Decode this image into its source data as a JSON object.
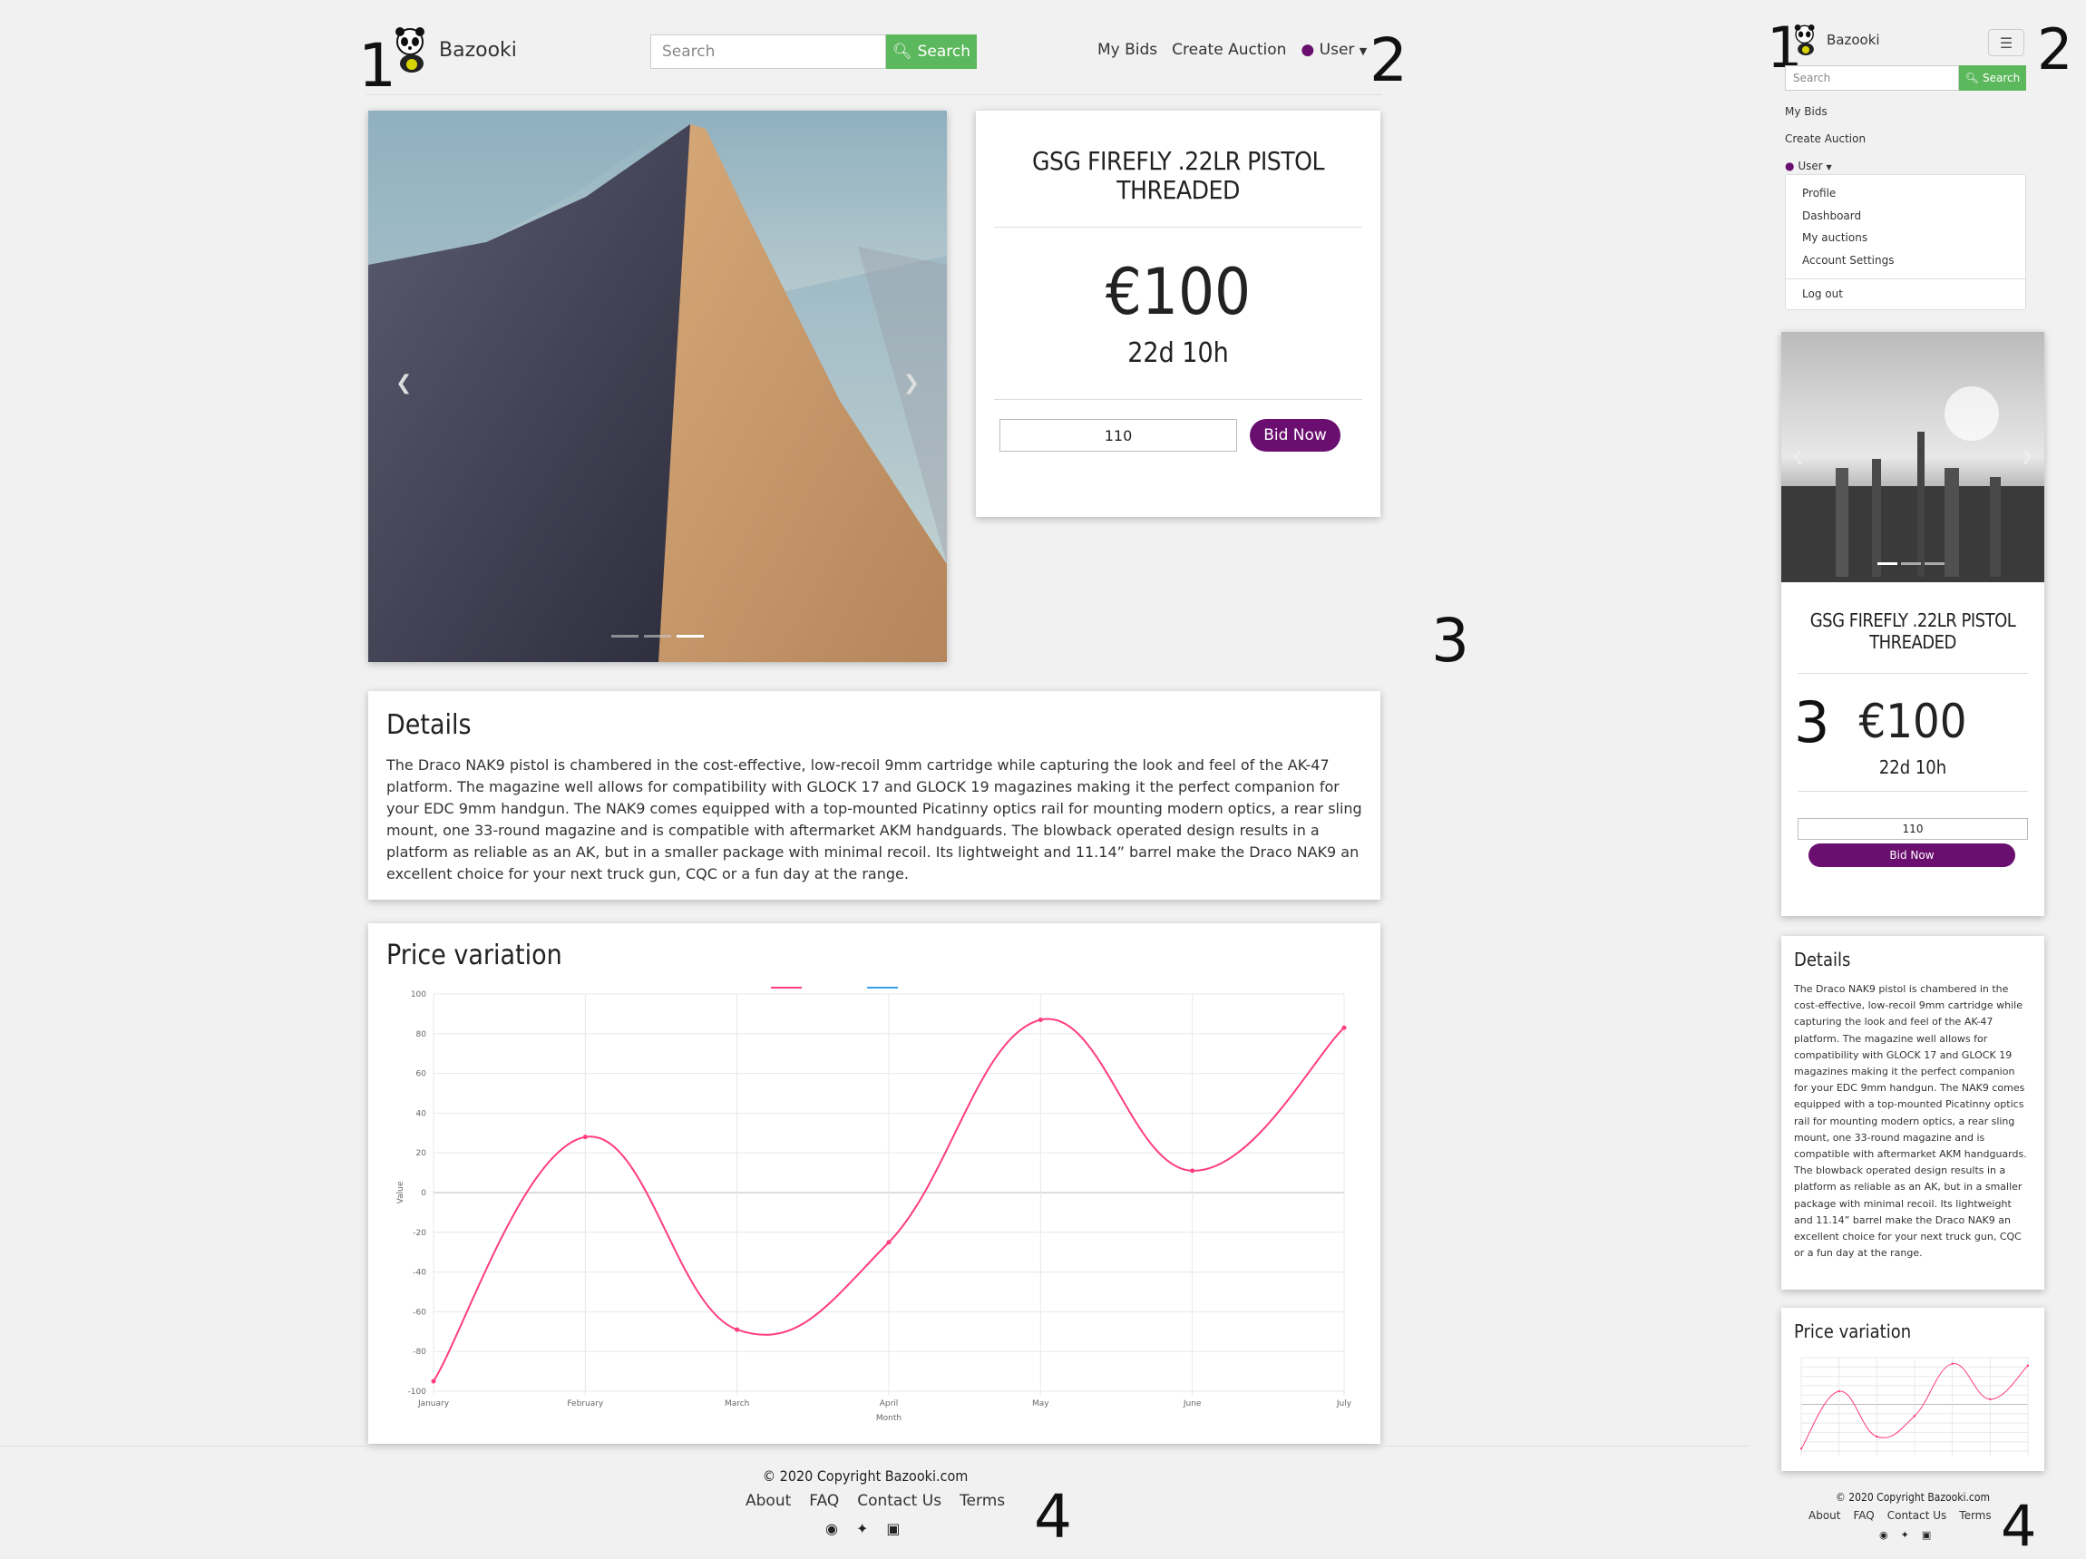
{
  "brand": {
    "name": "Bazooki"
  },
  "search": {
    "placeholder": "Search",
    "button": "Search"
  },
  "nav": {
    "my_bids": "My Bids",
    "create_auction": "Create Auction",
    "user": "User"
  },
  "user_menu": {
    "items": [
      "Profile",
      "Dashboard",
      "My auctions",
      "Account Settings"
    ],
    "logout": "Log out"
  },
  "auction": {
    "title": "GSG FIREFLY .22LR PISTOL THREADED",
    "price": "€100",
    "time_left": "22d 10h",
    "bid_value": "110",
    "bid_button": "Bid Now"
  },
  "details": {
    "heading": "Details",
    "text": "The Draco NAK9 pistol is chambered in the cost-effective, low-recoil 9mm cartridge while capturing the look and feel of the AK-47 platform. The magazine well allows for compatibility with GLOCK 17 and GLOCK 19 magazines making it the perfect companion for your EDC 9mm handgun. The NAK9 comes equipped with a top-mounted Picatinny optics rail for mounting modern optics, a rear sling mount, one 33-round magazine and is compatible with aftermarket AKM handguards. The blowback operated design results in a platform as reliable as an AK, but in a smaller package with minimal recoil. Its lightweight and 11.14” barrel make the Draco NAK9 an excellent choice for your next truck gun, CQC or a fun day at the range."
  },
  "price_chart": {
    "heading": "Price variation"
  },
  "chart_data": {
    "type": "line",
    "categories": [
      "January",
      "February",
      "March",
      "April",
      "May",
      "June",
      "July"
    ],
    "series": [
      {
        "values": [
          -95,
          28,
          -69,
          -25,
          87,
          11,
          83
        ],
        "color": "#ff3d7f"
      },
      {
        "values": [],
        "color": "#36a2eb"
      }
    ],
    "xlabel": "Month",
    "ylabel": "Value",
    "ylim": [
      -100,
      100
    ],
    "yticks": [
      100,
      80,
      60,
      40,
      20,
      0,
      -20,
      -40,
      -60,
      -80,
      -100
    ],
    "grid": true
  },
  "footer": {
    "copyright": "© 2020 Copyright Bazooki.com",
    "links": [
      "About",
      "FAQ",
      "Contact Us",
      "Terms"
    ],
    "social": [
      "facebook-icon",
      "twitter-icon",
      "instagram-icon"
    ]
  },
  "annotations": {
    "a1": "1",
    "a2": "2",
    "a3": "3",
    "a4": "4"
  },
  "colors": {
    "accent": "#6a0f6f",
    "search_btn": "#5cb85c",
    "line": "#ff3d7f"
  }
}
